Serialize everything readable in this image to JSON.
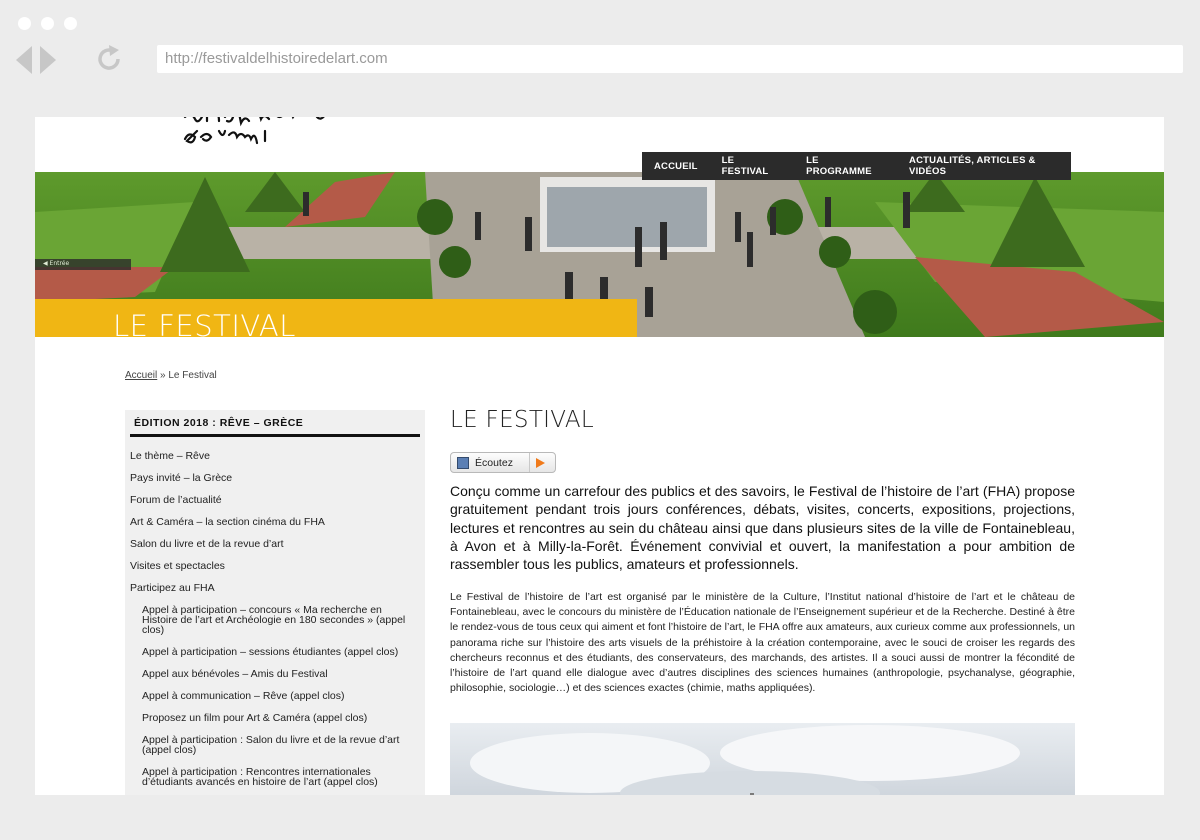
{
  "browser": {
    "url": "http://festivaldelhistoiredelart.com"
  },
  "site": {
    "logo_text": "art histoire de l'art"
  },
  "topnav": {
    "items": [
      "ACCUEIL",
      "LE FESTIVAL",
      "LE PROGRAMME",
      "ACTUALITÉS, ARTICLES & VIDÉOS"
    ]
  },
  "hero": {
    "title": "LE FESTIVAL",
    "tag": "◀ Entrée"
  },
  "breadcrumb": {
    "home": "Accueil",
    "separator": "»",
    "current": "Le Festival"
  },
  "sidebar": {
    "title": "ÉDITION 2018 : RÊVE – GRÈCE",
    "items": [
      "Le thème – Rêve",
      "Pays invité – la Grèce",
      "Forum de l’actualité",
      "Art & Caméra – la section cinéma du FHA",
      "Salon du livre et de la revue d’art",
      "Visites et spectacles",
      "Participez au FHA"
    ],
    "subitems": [
      "Appel à participation – concours « Ma recherche en Histoire de l’art et Archéologie en 180 secondes » (appel clos)",
      "Appel à participation – sessions étudiantes (appel clos)",
      "Appel aux bénévoles – Amis du Festival",
      "Appel à communication – Rêve (appel clos)",
      "Proposez un film pour Art & Caméra (appel clos)",
      "Appel à participation : Salon du livre et de la revue d’art (appel clos)",
      "Appel à participation : Rencontres internationales d’étudiants avancés en histoire de l’art (appel clos)"
    ]
  },
  "main": {
    "title": "LE FESTIVAL",
    "listen_label": "Écoutez",
    "lead": "Conçu comme un carrefour des publics et des savoirs, le Festival de l’histoire de l’art (FHA) propose gratuitement pendant trois jours conférences, débats, visites, concerts, expositions, projections, lectures et rencontres au sein du château ainsi que dans plusieurs sites de la ville de Fontainebleau, à Avon et à Milly-la-Forêt. Événement convivial et ouvert, la manifestation a pour ambition de rassembler tous les publics, amateurs et professionnels.",
    "body": "Le Festival de l’histoire de l’art est organisé par le ministère de la Culture, l’Institut national d’histoire de l’art et le château de Fontainebleau, avec le concours du ministère de l’Éducation nationale de l’Enseignement supérieur et de la Recherche. Destiné à être le rendez-vous de tous ceux qui aiment et font l’histoire de l’art, le FHA offre aux amateurs, aux curieux comme aux professionnels, un panorama riche sur l’histoire des arts visuels de la préhistoire à la création contemporaine, avec le souci de croiser les regards des chercheurs reconnus et des étudiants, des conservateurs, des marchands, des artistes. Il a souci aussi de montrer la fécondité de l’histoire de l’art quand elle dialogue avec d’autres disciplines des sciences humaines (anthropologie, psychanalyse, géographie, philosophie, sociologie…) et des sciences exactes (chimie, maths appliquées)."
  },
  "colors": {
    "accent_yellow": "#f0b614",
    "nav_dark": "#2b2b2b",
    "sidebar_bg": "#f0f0f0"
  }
}
